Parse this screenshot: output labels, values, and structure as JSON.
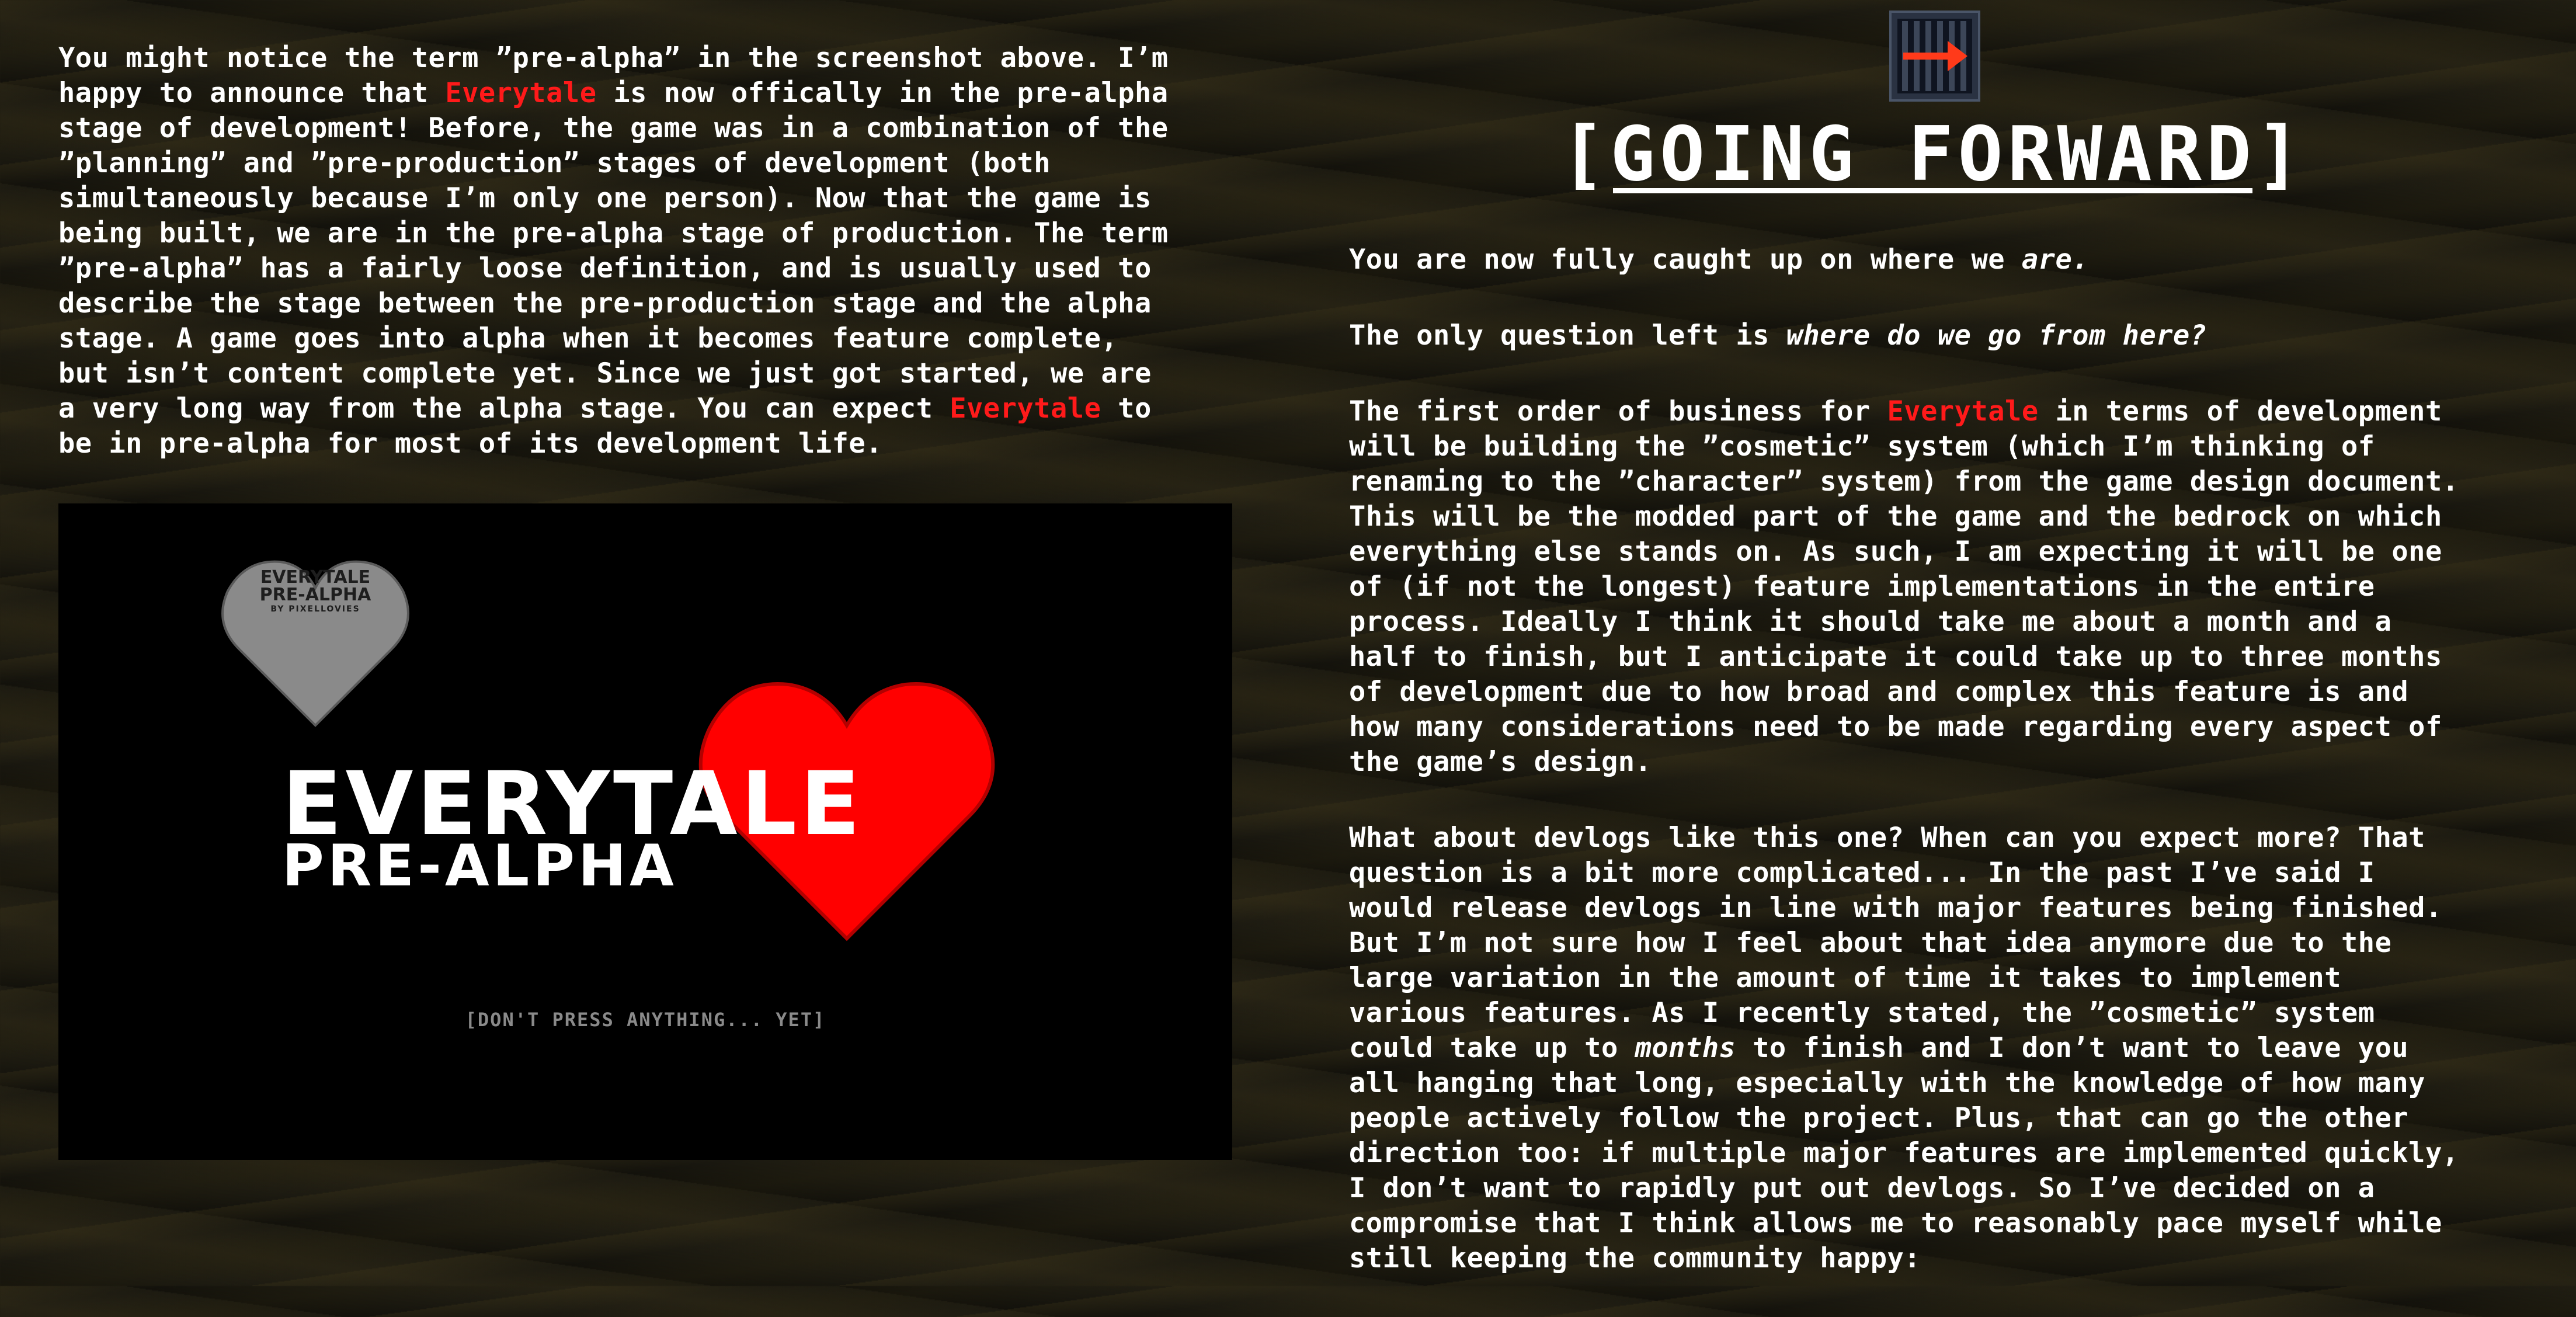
{
  "left": {
    "p1": [
      {
        "t": "You might notice the term ”pre-alpha” in the screenshot above. I’m\nhappy to announce that "
      },
      {
        "t": "Everytale",
        "red": true
      },
      {
        "t": " is now offically in the pre-alpha\nstage of development! Before, the game was in a combination of the\n”planning” and ”pre-production” stages of development (both\nsimultaneously because I’m only one person). Now that the game is\nbeing built, we are in the pre-alpha stage of production. The term\n”pre-alpha” has a fairly loose definition, and is usually used to\ndescribe the stage between the pre-production stage and the alpha\nstage. A game goes into alpha when it becomes feature complete,\nbut isn’t content complete yet. Since we just got started, we are\na very long way from the alpha stage. You can expect "
      },
      {
        "t": "Everytale",
        "red": true
      },
      {
        "t": " to\nbe in pre-alpha for most of its development life."
      }
    ]
  },
  "banner": {
    "badge_line1": "EVERYTALE",
    "badge_line2": "PRE-ALPHA",
    "badge_line3": "BY PIXELLOVIES",
    "logo_line1": "EVERYTALE",
    "logo_line2": "PRE-ALPHA",
    "prompt": "[DON'T PRESS ANYTHING... YET]",
    "heart_color": "#ff0000",
    "badge_color": "#8a8a8a"
  },
  "right": {
    "title": "[GOING FORWARD]",
    "p1": [
      {
        "t": "You are now fully caught up on where we "
      },
      {
        "t": "are.",
        "em": true
      }
    ],
    "p2": [
      {
        "t": "The only question left is "
      },
      {
        "t": "where do we go from here?",
        "em": true
      }
    ],
    "p3": [
      {
        "t": "The first order of business for "
      },
      {
        "t": "Everytale",
        "red": true
      },
      {
        "t": " in terms of development\nwill be building the ”cosmetic” system (which I’m thinking of\nrenaming to the ”character” system) from the game design document.\nThis will be the modded part of the game and the bedrock on which\neverything else stands on. As such, I am expecting it will be one\nof (if not the longest) feature implementations in the entire\nprocess. Ideally I think it should take me about a month and a\nhalf to finish, but I anticipate it could take up to three months\nof development due to how broad and complex this feature is and\nhow many considerations need to be made regarding every aspect of\nthe game’s design."
      }
    ],
    "p4": [
      {
        "t": "What about devlogs like this one? When can you expect more? That\nquestion is a bit more complicated... In the past I’ve said I\nwould release devlogs in line with major features being finished.\nBut I’m not sure how I feel about that idea anymore due to the\nlarge variation in the amount of time it takes to implement\nvarious features. As I recently stated, the ”cosmetic” system\ncould take up to "
      },
      {
        "t": "months",
        "em": true
      },
      {
        "t": " to finish and I don’t want to leave you\nall hanging that long, especially with the knowledge of how many\npeople actively follow the project. Plus, that can go the other\ndirection too: if multiple major features are implemented quickly,\nI don’t want to rapidly put out devlogs. So I’ve decided on a\ncompromise that I think allows me to reasonably pace myself while\nstill keeping the community happy:"
      }
    ]
  },
  "icons": {
    "exit": "exit-door-arrow-icon",
    "heart": "heart-icon",
    "badge": "heart-badge-icon"
  },
  "colors": {
    "accent_red": "#ff1a1a",
    "text": "#ffffff",
    "background": "#1c1a11"
  }
}
